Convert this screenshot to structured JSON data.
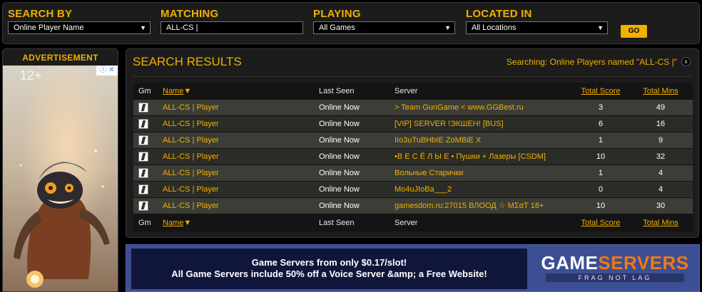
{
  "search": {
    "by_label": "SEARCH BY",
    "by_value": "Online Player Name",
    "matching_label": "MATCHING",
    "matching_value": "ALL-CS |",
    "playing_label": "PLAYING",
    "playing_value": "All Games",
    "located_label": "LOCATED IN",
    "located_value": "All Locations",
    "go_label": "GO"
  },
  "ad": {
    "title": "ADVERTISEMENT",
    "badge": "12+",
    "adchoice_icon": "info-icon"
  },
  "results": {
    "title": "SEARCH RESULTS",
    "status": "Searching: Online Players named \"ALL-CS |\"",
    "close_label": "x",
    "columns": {
      "gm": "Gm",
      "name": "Name",
      "sort_indicator": "▼",
      "last_seen": "Last Seen",
      "server": "Server",
      "total_score": "Total Score",
      "total_mins": "Total Mins"
    },
    "rows": [
      {
        "name": "ALL-CS | Player",
        "last_seen": "Online Now",
        "server": "> Team GunGame < www.GGBest.ru",
        "score": "3",
        "mins": "49"
      },
      {
        "name": "ALL-CS | Player",
        "last_seen": "Online Now",
        "server": "[VIP] SERVER !ЭКШЕН! [BUS]",
        "score": "6",
        "mins": "16"
      },
      {
        "name": "ALL-CS | Player",
        "last_seen": "Online Now",
        "server": "IIo3uTuBHbIE ZoMBiE X",
        "score": "1",
        "mins": "9"
      },
      {
        "name": "ALL-CS | Player",
        "last_seen": "Online Now",
        "server": "•В Е С Ё Л Ы Е • Пушки + Лазеры [CSDM]",
        "score": "10",
        "mins": "32"
      },
      {
        "name": "ALL-CS | Player",
        "last_seen": "Online Now",
        "server": "Вольные Старички",
        "score": "1",
        "mins": "4"
      },
      {
        "name": "ALL-CS | Player",
        "last_seen": "Online Now",
        "server": "Mo4uJIoBa___2",
        "score": "0",
        "mins": "4"
      },
      {
        "name": "ALL-CS | Player",
        "last_seen": "Online Now",
        "server": "gamesdom.ru:27015 ВЛООД ☆ MΣαT 18+",
        "score": "10",
        "mins": "30"
      }
    ]
  },
  "banner": {
    "line1": "Game Servers from only $0.17/slot!",
    "line2": "All Game Servers include 50% off a Voice Server &amp; a Free Website!",
    "logo_main_part1": "GAME",
    "logo_main_part2": "SERVERS",
    "logo_sub": "FRAG NOT LAG"
  },
  "colors": {
    "accent": "#f0b000",
    "panel": "#1c1c1c",
    "row_odd": "#3b3d36",
    "row_even": "#2b2c27",
    "banner_bg": "#3c4f94",
    "logo_orange": "#f07a10"
  }
}
